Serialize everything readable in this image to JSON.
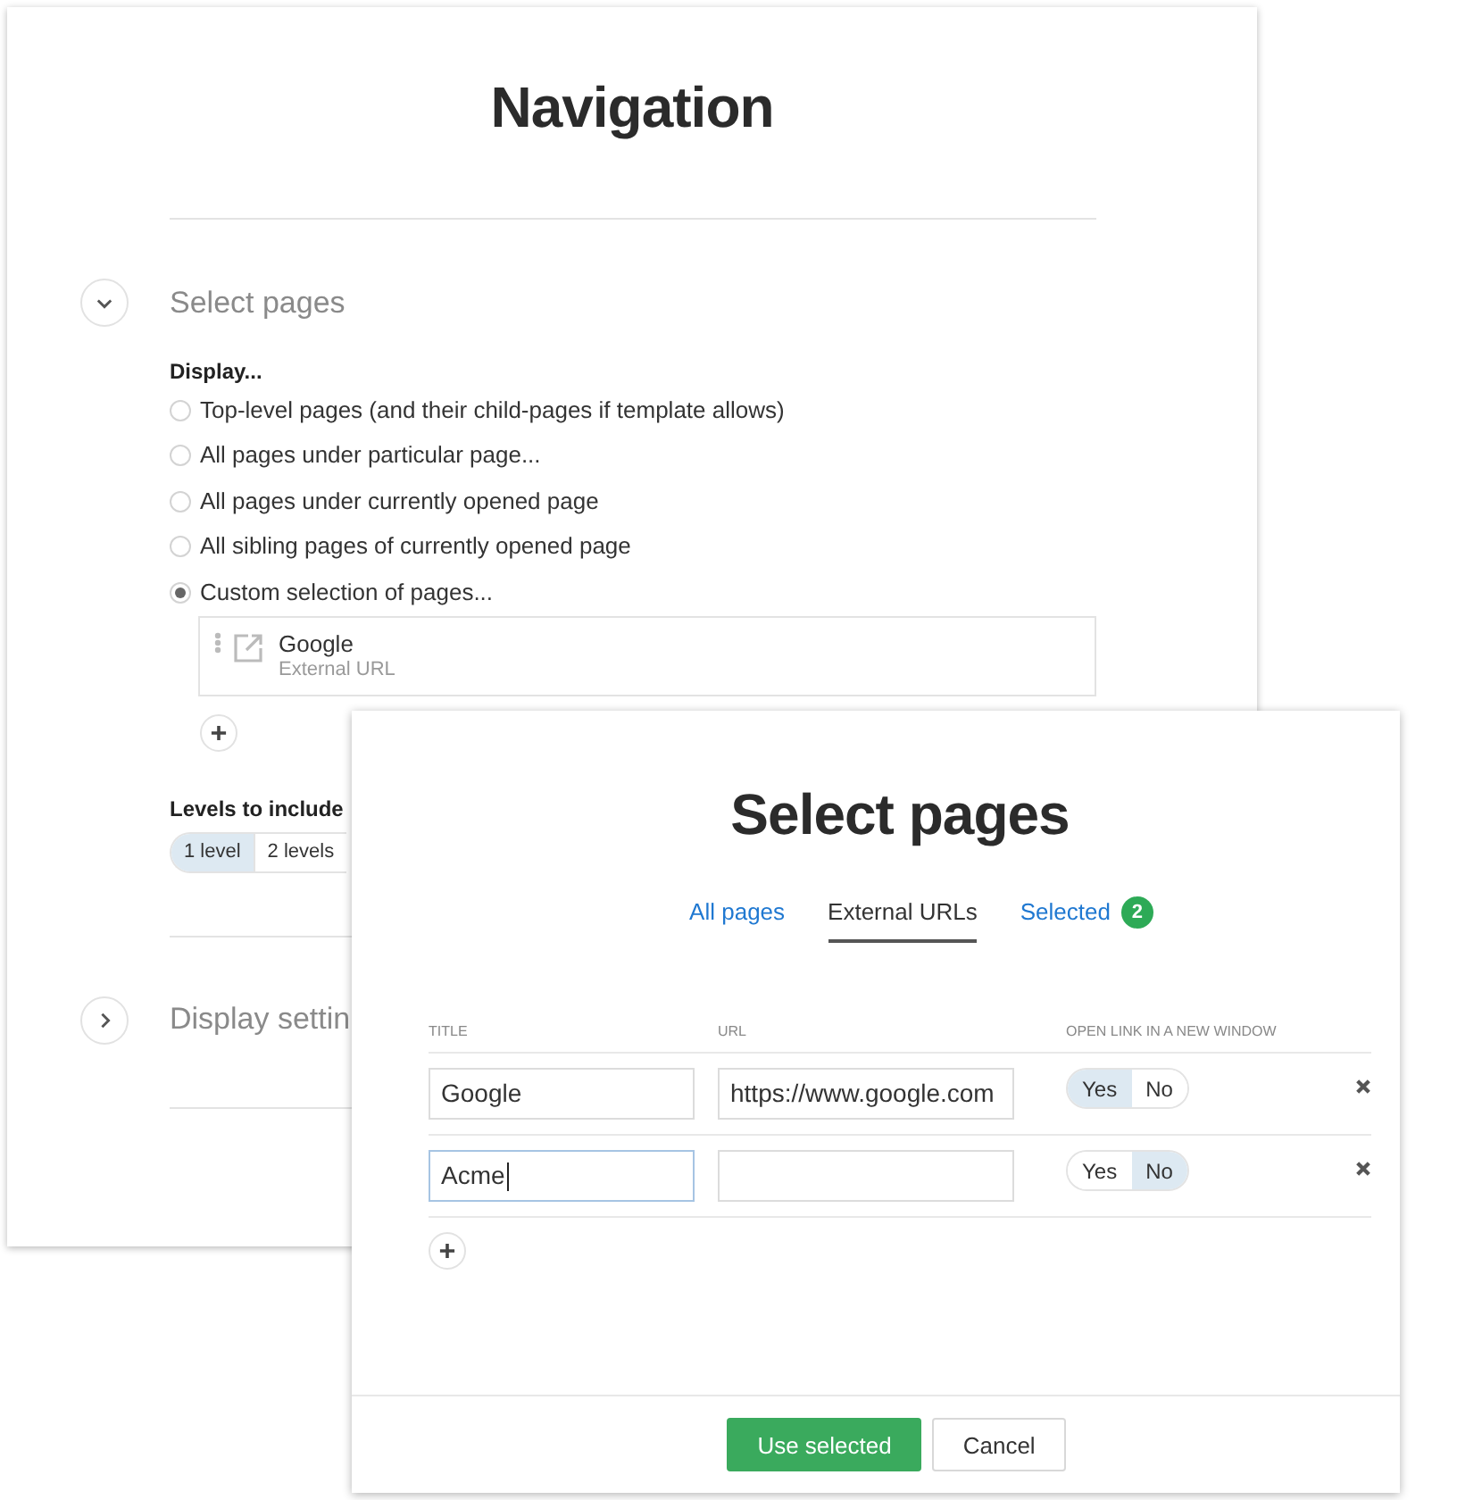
{
  "navigation": {
    "title": "Navigation",
    "sections": [
      {
        "title": "Select pages",
        "expanded": true,
        "display": {
          "label": "Display...",
          "options": [
            {
              "label": "Top-level pages (and their child-pages if template allows)",
              "selected": false
            },
            {
              "label": "All pages under particular page...",
              "selected": false
            },
            {
              "label": "All pages under currently opened page",
              "selected": false
            },
            {
              "label": "All sibling pages of currently opened page",
              "selected": false
            },
            {
              "label": "Custom selection of pages...",
              "selected": true
            }
          ]
        },
        "items": [
          {
            "title": "Google",
            "subtitle": "External URL"
          }
        ],
        "levels": {
          "label": "Levels to include",
          "options": [
            {
              "label": "1 level",
              "selected": true
            },
            {
              "label": "2 levels",
              "selected": false
            }
          ]
        }
      },
      {
        "title": "Display settin",
        "expanded": false
      }
    ]
  },
  "dialog": {
    "title": "Select pages",
    "tabs": [
      {
        "label": "All pages",
        "selected": false
      },
      {
        "label": "External URLs",
        "selected": true
      },
      {
        "label": "Selected",
        "selected": false,
        "badge": "2"
      }
    ],
    "columns": [
      "TITLE",
      "URL",
      "OPEN LINK IN A NEW WINDOW"
    ],
    "rows": [
      {
        "title": "Google",
        "focused": false,
        "url": "https://www.google.com",
        "new_window": [
          {
            "label": "Yes",
            "selected": true
          },
          {
            "label": "No",
            "selected": false
          }
        ]
      },
      {
        "title": "Acme",
        "focused": true,
        "new_window": [
          {
            "label": "Yes",
            "selected": false
          },
          {
            "label": "No",
            "selected": true
          }
        ]
      }
    ],
    "buttons": [
      {
        "label": "Use selected",
        "kind": "primary"
      },
      {
        "label": "Cancel",
        "kind": "secondary"
      }
    ]
  }
}
